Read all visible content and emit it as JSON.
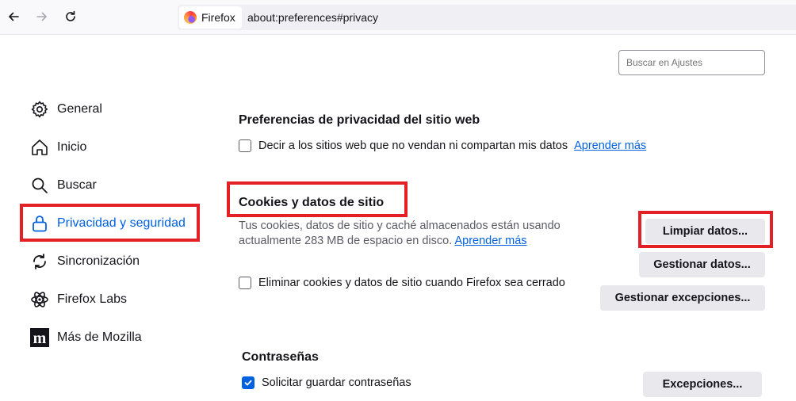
{
  "toolbar": {
    "identity_label": "Firefox",
    "url": "about:preferences#privacy",
    "icons": [
      "back-arrow-icon",
      "forward-arrow-icon",
      "reload-icon",
      "firefox-logo-icon"
    ]
  },
  "search": {
    "placeholder": "Buscar en Ajustes"
  },
  "sidebar": {
    "items": [
      {
        "label": "General",
        "icon": "gear-icon"
      },
      {
        "label": "Inicio",
        "icon": "home-icon"
      },
      {
        "label": "Buscar",
        "icon": "search-icon"
      },
      {
        "label": "Privacidad y seguridad",
        "icon": "lock-icon",
        "active": true
      },
      {
        "label": "Sincronización",
        "icon": "sync-icon"
      },
      {
        "label": "Firefox Labs",
        "icon": "atom-icon"
      },
      {
        "label": "Más de Mozilla",
        "icon": "mozilla-logo-icon"
      }
    ]
  },
  "privacy_prefs": {
    "title": "Preferencias de privacidad del sitio web",
    "dont_sell_label": "Decir a los sitios web que no vendan ni compartan mis datos",
    "dont_sell_checked": false,
    "learn_more": "Aprender más"
  },
  "cookies": {
    "title": "Cookies y datos de sitio",
    "description": "Tus cookies, datos de sitio y caché almacenados están usando actualmente 283 MB de espacio en disco.",
    "learn_more": "Aprender más",
    "clear_button": "Limpiar datos...",
    "manage_button": "Gestionar datos...",
    "delete_on_close_label": "Eliminar cookies y datos de sitio cuando Firefox sea cerrado",
    "delete_on_close_checked": false,
    "exceptions_button": "Gestionar excepciones..."
  },
  "passwords": {
    "title": "Contraseñas",
    "ask_save_label": "Solicitar guardar contraseñas",
    "ask_save_checked": true,
    "exceptions_button": "Excepciones..."
  },
  "colors": {
    "accent": "#0061e0",
    "highlight": "#e22026",
    "button_bg": "#e9e9ed"
  }
}
